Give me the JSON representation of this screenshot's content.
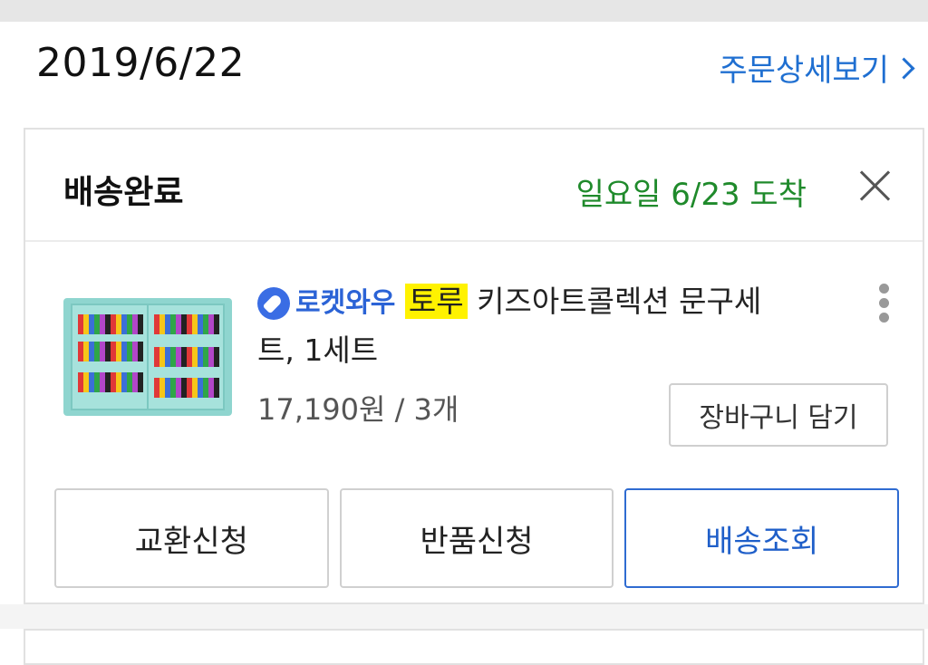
{
  "order": {
    "date": "2019/6/22",
    "detail_link": "주문상세보기"
  },
  "shipment": {
    "status": "배송완료",
    "arrival": "일요일 6/23 도착"
  },
  "product": {
    "badge_text": "로켓와우",
    "brand": "토루",
    "name_line1": "키즈아트콜렉션 문구세",
    "name_line2": "트, 1세트",
    "price_qty": "17,190원 / 3개",
    "cart_button": "장바구니 담기"
  },
  "actions": {
    "exchange": "교환신청",
    "return": "반품신청",
    "tracking": "배송조회"
  },
  "colors": {
    "link_blue": "#1f6fd1",
    "arrival_green": "#1f8a2b",
    "highlight_yellow": "#fff200"
  },
  "icons": {
    "chevron": "chevron-right-icon",
    "close": "close-icon",
    "more": "more-vertical-icon",
    "rocket": "rocket-icon"
  }
}
